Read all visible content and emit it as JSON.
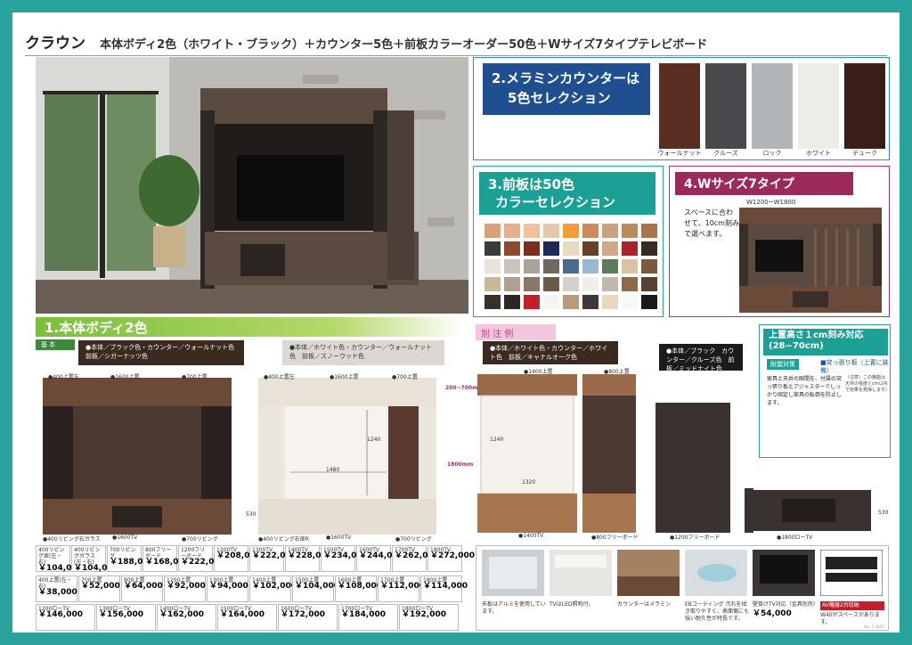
{
  "header": {
    "brand": "クラウン",
    "headline": "本体ボディ2色（ホワイト・ブラック）＋カウンター5色＋前板カラーオーダー50色＋Wサイズ7タイプテレビボード"
  },
  "section2": {
    "title_line1": "2.メラミンカウンターは",
    "title_line2": "5色セレクション",
    "swatches": [
      {
        "label": "ウォールナット",
        "color": "#5a2f22"
      },
      {
        "label": "クルーズ",
        "color": "#4a4a4e"
      },
      {
        "label": "ロック",
        "color": "#b2b5b8"
      },
      {
        "label": "ホワイト",
        "color": "#eeece7"
      },
      {
        "label": "デューク",
        "color": "#3b1e18"
      }
    ]
  },
  "section3": {
    "title_line1": "3.前板は50色",
    "title_line2": "カラーセレクション",
    "colors": [
      "#d9a07a",
      "#e6b08c",
      "#f0c19a",
      "#e3c9a8",
      "#f29c3a",
      "#d08a5a",
      "#c9a37f",
      "#b98a5e",
      "#a87448",
      "#3d3b3a",
      "#8c4a30",
      "#7a2e20",
      "#1e2b5a",
      "#e8d9c0",
      "#6b3e2a",
      "#cfa98a",
      "#a8242a",
      "#3a2a22",
      "#e9e4db",
      "#c9c4bb",
      "#a9a49b",
      "#6e6a63",
      "#4a6b8a",
      "#9bb7cf",
      "#5a7e5a",
      "#d8c4a0",
      "#7a5a3a",
      "#c8b89a",
      "#b0a090",
      "#887868",
      "#6a5a4a",
      "#d5d0c8",
      "#f1eee8",
      "#bfb8ad",
      "#8b6b4b",
      "#5a4030",
      "#3a2e28",
      "#2e2624",
      "#c0202a",
      "#f6f4ef",
      "#b99a7a",
      "#3c3936",
      "#e8d8c0",
      "#f8f8f6",
      "#1a1818"
    ]
  },
  "section4": {
    "title": "4.Wサイズ7タイプ",
    "width_label": "W1200~W1800",
    "desc": "スペースに合わせて、10cm刻みで選べます。"
  },
  "section1": {
    "title": "1.本体ボディ2色",
    "basic_tag": "基 本",
    "black_caption": "●本体／ブラック色・カウンター／ウォールナット色　前板／シガーナッツ色",
    "white_caption": "●本体／ホワイト色・カウンター／ウォールナット色　前板／スノーウッド色",
    "black_labels": [
      "●400上置左",
      "●1600上置",
      "●700上置",
      "●400リビング右ガラス",
      "●1600TV",
      "●700リビング"
    ],
    "white_labels": [
      "●400上置左",
      "●1600上置",
      "●700上置",
      "●400リビング右扉R",
      "●1600TV",
      "●700リビング"
    ],
    "dims": {
      "w1480": "1480",
      "h1240": "1240",
      "h530": "530",
      "h1800": "1800mm",
      "h200": "200~700mm"
    }
  },
  "prices": {
    "row1": [
      {
        "name": "400リビング扉(左・右)",
        "price": "￥104,000"
      },
      {
        "name": "400リビングガラス(左・右)",
        "price": "￥104,000"
      },
      {
        "name": "700リビング",
        "price": "￥188,000"
      },
      {
        "name": "800フリーボード",
        "price": "￥168,000"
      },
      {
        "name": "1200フリーボード",
        "price": "￥222,000"
      },
      {
        "name": "1200TV",
        "price": "￥208,000"
      },
      {
        "name": "1300TV",
        "price": "￥222,000"
      },
      {
        "name": "1400TV",
        "price": "￥228,000"
      },
      {
        "name": "1500TV",
        "price": "￥234,000"
      },
      {
        "name": "1600TV",
        "price": "￥244,000"
      },
      {
        "name": "1700TV",
        "price": "￥262,000"
      },
      {
        "name": "1800TV",
        "price": "￥272,000"
      }
    ],
    "row2": [
      {
        "name": "400上置(左・右)",
        "price": "￥38,000"
      },
      {
        "name": "700上置",
        "price": "￥52,000"
      },
      {
        "name": "800上置",
        "price": "￥64,000"
      },
      {
        "name": "1200上置",
        "price": "￥92,000"
      },
      {
        "name": "1300上置",
        "price": "￥94,000"
      },
      {
        "name": "1400上置",
        "price": "￥102,000"
      },
      {
        "name": "1500上置",
        "price": "￥104,000"
      },
      {
        "name": "1600上置",
        "price": "￥108,000"
      },
      {
        "name": "1700上置",
        "price": "￥112,000"
      },
      {
        "name": "1800上置",
        "price": "￥114,000"
      }
    ],
    "row3": [
      {
        "name": "1200ローTV",
        "price": "￥146,000"
      },
      {
        "name": "1300ローTV",
        "price": "￥156,000"
      },
      {
        "name": "1400ローTV",
        "price": "￥162,000"
      },
      {
        "name": "1500ローTV",
        "price": "￥164,000"
      },
      {
        "name": "1600ローTV",
        "price": "￥172,000"
      },
      {
        "name": "1700ローTV",
        "price": "￥184,000"
      },
      {
        "name": "1800ローTV",
        "price": "￥192,000"
      }
    ],
    "tax_note": "(本体価格)"
  },
  "example": {
    "label": "別 注 例",
    "caption_a": "●本体／ホワイト色・カウンター／ホワイト色　前板／キャナルオーク色",
    "caption_b": "●本体／ブラック　カウンター／クルーズ色　前板／ミッドナイト色",
    "labels": [
      "●1400上置",
      "●800上置",
      "●1400TV",
      "●800フリーボード",
      "●1200フリーボード",
      "●1800ローTV"
    ],
    "dims": {
      "h1240": "1240",
      "w1320": "1320",
      "h530": "530"
    }
  },
  "section5": {
    "title_line1": "上置高さ１cm刻み対応",
    "title_line2": "(28~70cm)",
    "tag": "耐震対策",
    "note": "■突っ張り板（上置に装備）",
    "desc": "家具と天井の隙間を、付属の突っ張り板とアジャスターでしっかり固定し家具の転倒を防止します。",
    "side": "（注意）この機能は天井の強度とcm以内で効果を発揮します）"
  },
  "features": [
    {
      "text": "天板はアルミを使用しています。"
    },
    {
      "text": "TVはLED照明付。"
    },
    {
      "text": "カウンターはメラミン"
    },
    {
      "text": "EBコーティング 汚れを拭き取りやすく、表面傷にも強い耐久性が特長です。"
    },
    {
      "text": "壁掛けTV対応（金具別売）",
      "price": "￥54,000"
    },
    {
      "text": "AV機器2台収納",
      "sub": "W40がスペースがあります。"
    }
  ],
  "footer": "Ver. 1  08/07"
}
